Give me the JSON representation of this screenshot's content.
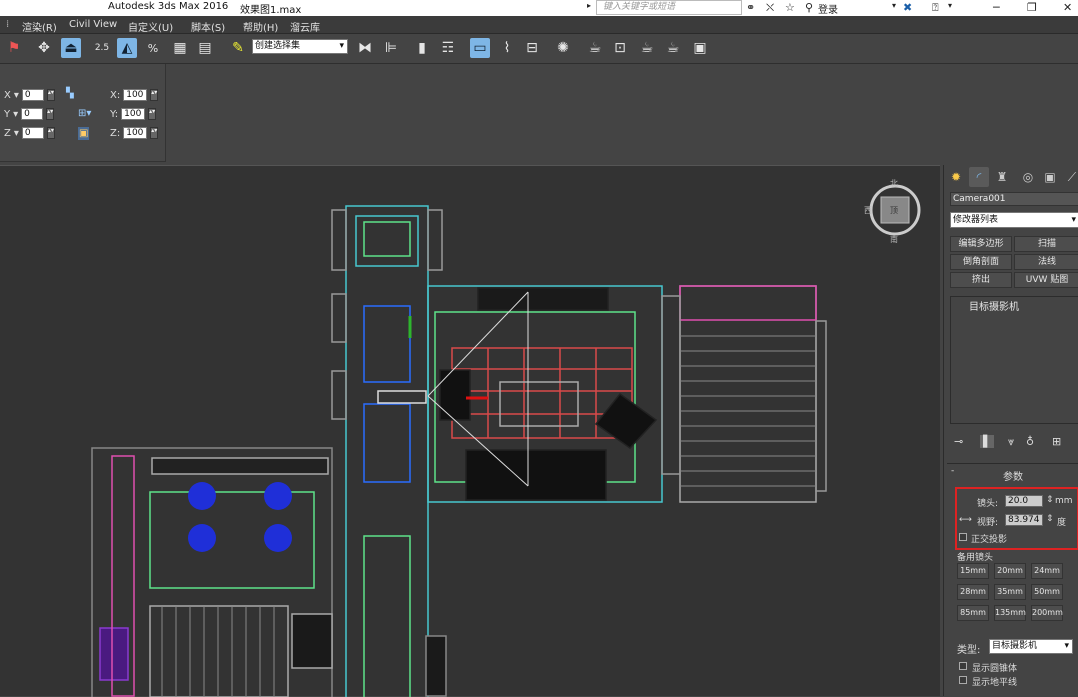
{
  "titlebar": {
    "app": "Autodesk 3ds Max 2016",
    "file": "效果图1.max",
    "search_placeholder": "键入关键字或短语",
    "login": "登录"
  },
  "menu": [
    "渲染(R)",
    "Civil View",
    "自定义(U)",
    "脚本(S)",
    "帮助(H)",
    "溜云库"
  ],
  "toolbar": {
    "snap_angle": "2.5",
    "selection_set": "创建选择集"
  },
  "transform": {
    "rows": [
      {
        "axis": "X",
        "value": "0",
        "scale_axis": "X:",
        "scale_value": "100"
      },
      {
        "axis": "Y",
        "value": "0",
        "scale_axis": "Y:",
        "scale_value": "100"
      },
      {
        "axis": "Z",
        "value": "0",
        "scale_axis": "Z:",
        "scale_value": "100"
      }
    ]
  },
  "viewcube": {
    "north": "北",
    "south": "南",
    "west": "西",
    "face": "顶"
  },
  "command_panel": {
    "object_name": "Camera001",
    "modifier_list": "修改器列表",
    "modifier_buttons": [
      "编辑多边形",
      "扫描",
      "倒角剖面",
      "法线",
      "挤出",
      "UVW 贴图"
    ],
    "stack_item": "目标摄影机",
    "params_title": "参数",
    "lens_label": "镜头:",
    "lens_value": "20.0",
    "lens_unit": "mm",
    "fov_label": "视野:",
    "fov_value": "83.974",
    "fov_unit": "度",
    "ortho_label": "正交投影",
    "stock_lenses_title": "备用镜头",
    "stock_lenses": [
      "15mm",
      "20mm",
      "24mm",
      "28mm",
      "35mm",
      "50mm",
      "85mm",
      "135mm",
      "200mm"
    ],
    "type_label": "类型:",
    "type_value": "目标摄影机",
    "show_cone": "显示圆锥体",
    "show_horizon": "显示地平线"
  },
  "colors": {
    "accent": "#7eb6e6",
    "highlight": "#dd2222",
    "wire_cyan": "#40e0d0",
    "wire_green": "#5ee38a",
    "wire_pink": "#e04fb0",
    "wire_blue": "#2a50ff"
  }
}
